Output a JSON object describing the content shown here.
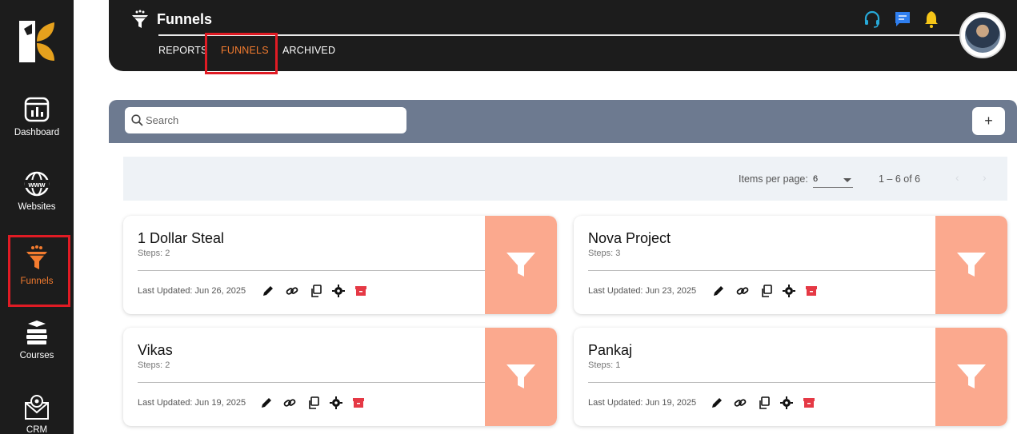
{
  "sidebar": {
    "items": [
      {
        "label": "Dashboard",
        "icon": "dashboard-icon"
      },
      {
        "label": "Websites",
        "icon": "globe-www-icon"
      },
      {
        "label": "Funnels",
        "icon": "funnel-icon",
        "active": true
      },
      {
        "label": "Courses",
        "icon": "books-icon"
      },
      {
        "label": "CRM",
        "icon": "crm-mail-icon"
      }
    ]
  },
  "header": {
    "title": "Funnels",
    "tabs": [
      {
        "label": "REPORTS"
      },
      {
        "label": "FUNNELS",
        "active": true
      },
      {
        "label": "ARCHIVED"
      }
    ],
    "icons": [
      "headset-icon",
      "chat-icon",
      "bell-icon"
    ]
  },
  "search": {
    "placeholder": "Search"
  },
  "add_button": {
    "label": "+"
  },
  "pagination": {
    "items_per_page_label": "Items per page:",
    "items_per_page": "6",
    "range": "1 – 6 of 6"
  },
  "funnels": [
    {
      "name": "1 Dollar Steal",
      "steps": "Steps: 2",
      "updated": "Last Updated: Jun 26, 2025"
    },
    {
      "name": "Nova Project",
      "steps": "Steps: 3",
      "updated": "Last Updated: Jun 23, 2025"
    },
    {
      "name": "Vikas",
      "steps": "Steps: 2",
      "updated": "Last Updated: Jun 19, 2025"
    },
    {
      "name": "Pankaj",
      "steps": "Steps: 1",
      "updated": "Last Updated: Jun 19, 2025"
    }
  ],
  "colors": {
    "dark": "#1c1c1c",
    "accent": "#f47c2f",
    "highlight": "#e01b24",
    "thumb": "#fba98e",
    "band": "#6d7a90",
    "archive": "#e53945"
  }
}
